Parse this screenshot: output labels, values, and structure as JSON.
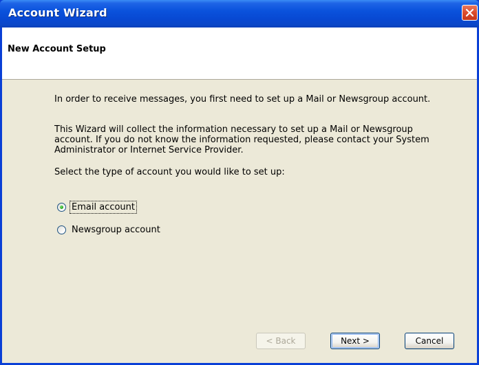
{
  "window": {
    "title": "Account Wizard"
  },
  "header": {
    "title": "New Account Setup"
  },
  "content": {
    "paragraph1": "In order to receive messages, you first need to set up a Mail or Newsgroup account.",
    "paragraph2": "This Wizard will collect the information necessary to set up a Mail or Newsgroup account. If you do not know the information requested, please contact your System Administrator or Internet Service Provider.",
    "prompt": "Select the type of account you would like to set up:"
  },
  "options": [
    {
      "label": "Email account",
      "selected": true
    },
    {
      "label": "Newsgroup account",
      "selected": false
    }
  ],
  "buttons": {
    "back": "< Back",
    "next": "Next >",
    "cancel": "Cancel"
  },
  "colors": {
    "titlebar": "#0a52dc",
    "close_button": "#db4c2c",
    "dialog_bg": "#ece9d8"
  },
  "icons": {
    "close": "close-icon"
  }
}
